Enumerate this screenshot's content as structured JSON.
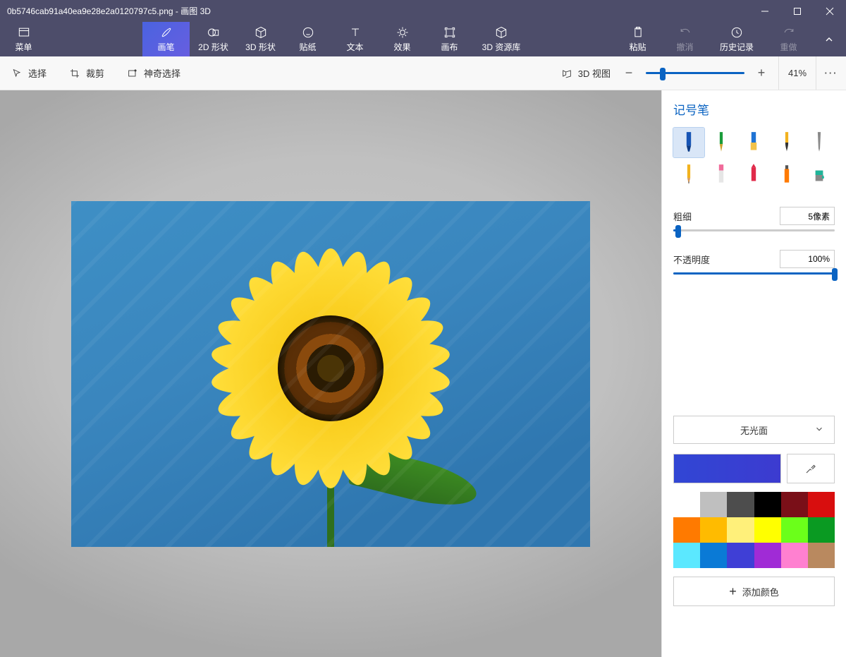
{
  "title": "0b5746cab91a40ea9e28e2a0120797c5.png - 画图 3D",
  "ribbon": {
    "menu": "菜单",
    "brush": "画笔",
    "shapes2d": "2D 形状",
    "shapes3d": "3D 形状",
    "stickers": "贴纸",
    "text": "文本",
    "effects": "效果",
    "canvas": "画布",
    "library3d": "3D 资源库",
    "paste": "粘贴",
    "undo": "撤消",
    "history": "历史记录",
    "redo": "重做"
  },
  "subbar": {
    "select": "选择",
    "crop": "裁剪",
    "magic_select": "神奇选择",
    "view3d": "3D 视图",
    "zoom_percent": "41%",
    "zoom_slider_pos": 0.17
  },
  "panel": {
    "title": "记号笔",
    "brushes": [
      {
        "name": "marker",
        "selected": true
      },
      {
        "name": "pen",
        "selected": false
      },
      {
        "name": "brush",
        "selected": false
      },
      {
        "name": "tip",
        "selected": false
      },
      {
        "name": "stylus",
        "selected": false
      },
      {
        "name": "pencil",
        "selected": false
      },
      {
        "name": "eraser",
        "selected": false
      },
      {
        "name": "crayon",
        "selected": false
      },
      {
        "name": "spray",
        "selected": false
      },
      {
        "name": "fill",
        "selected": false
      }
    ],
    "thickness_label": "粗细",
    "thickness_value": "5像素",
    "thickness_pos": 0.03,
    "opacity_label": "不透明度",
    "opacity_value": "100%",
    "opacity_pos": 1.0,
    "finish_label": "无光面",
    "add_color_label": "添加颜色",
    "palette": [
      "#ffffff",
      "#bfbfbf",
      "#4d4d4d",
      "#000000",
      "#7a0f18",
      "#d80e0e",
      "#ff7a00",
      "#ffbb00",
      "#fff07a",
      "#ffff00",
      "#6bff1a",
      "#0a9a22",
      "#5be8ff",
      "#0a7ad6",
      "#3f3fd6",
      "#a02bd6",
      "#ff80d0",
      "#b9895f"
    ]
  }
}
